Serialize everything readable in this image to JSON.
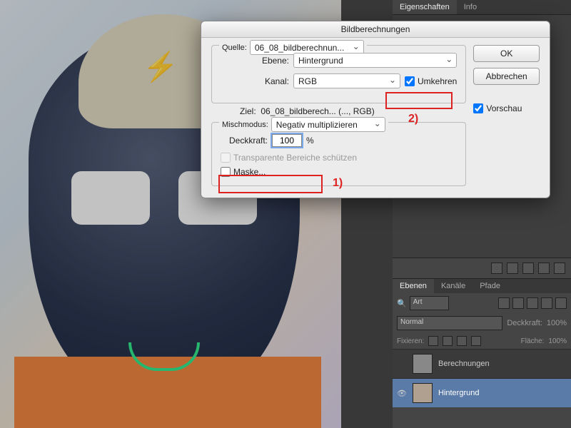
{
  "side": {
    "tabs": [
      "Eigenschaften",
      "Info"
    ],
    "layers_tabs": [
      "Ebenen",
      "Kanäle",
      "Pfade"
    ],
    "search_label": "Art",
    "blend_mode": "Normal",
    "opacity_label": "Deckkraft:",
    "opacity_value": "100%",
    "lock_label": "Fixieren:",
    "fill_label": "Fläche:",
    "fill_value": "100%",
    "layers": [
      {
        "name": "Berechnungen",
        "visible": false
      },
      {
        "name": "Hintergrund",
        "visible": true
      }
    ]
  },
  "dialog": {
    "title": "Bildberechnungen",
    "quelle_label": "Quelle:",
    "quelle_value": "06_08_bildberechnun...",
    "ebene_label": "Ebene:",
    "ebene_value": "Hintergrund",
    "kanal_label": "Kanal:",
    "kanal_value": "RGB",
    "umkehren_label": "Umkehren",
    "umkehren_checked": true,
    "ziel_label": "Ziel:",
    "ziel_value": "06_08_bildberech... (..., RGB)",
    "misch_label": "Mischmodus:",
    "misch_value": "Negativ multiplizieren",
    "deck_label": "Deckkraft:",
    "deck_value": "100",
    "deck_unit": "%",
    "trans_label": "Transparente Bereiche schützen",
    "mask_label": "Maske...",
    "ok": "OK",
    "cancel": "Abbrechen",
    "preview": "Vorschau",
    "preview_checked": true
  },
  "annotations": {
    "a1": "1)",
    "a2": "2)"
  }
}
